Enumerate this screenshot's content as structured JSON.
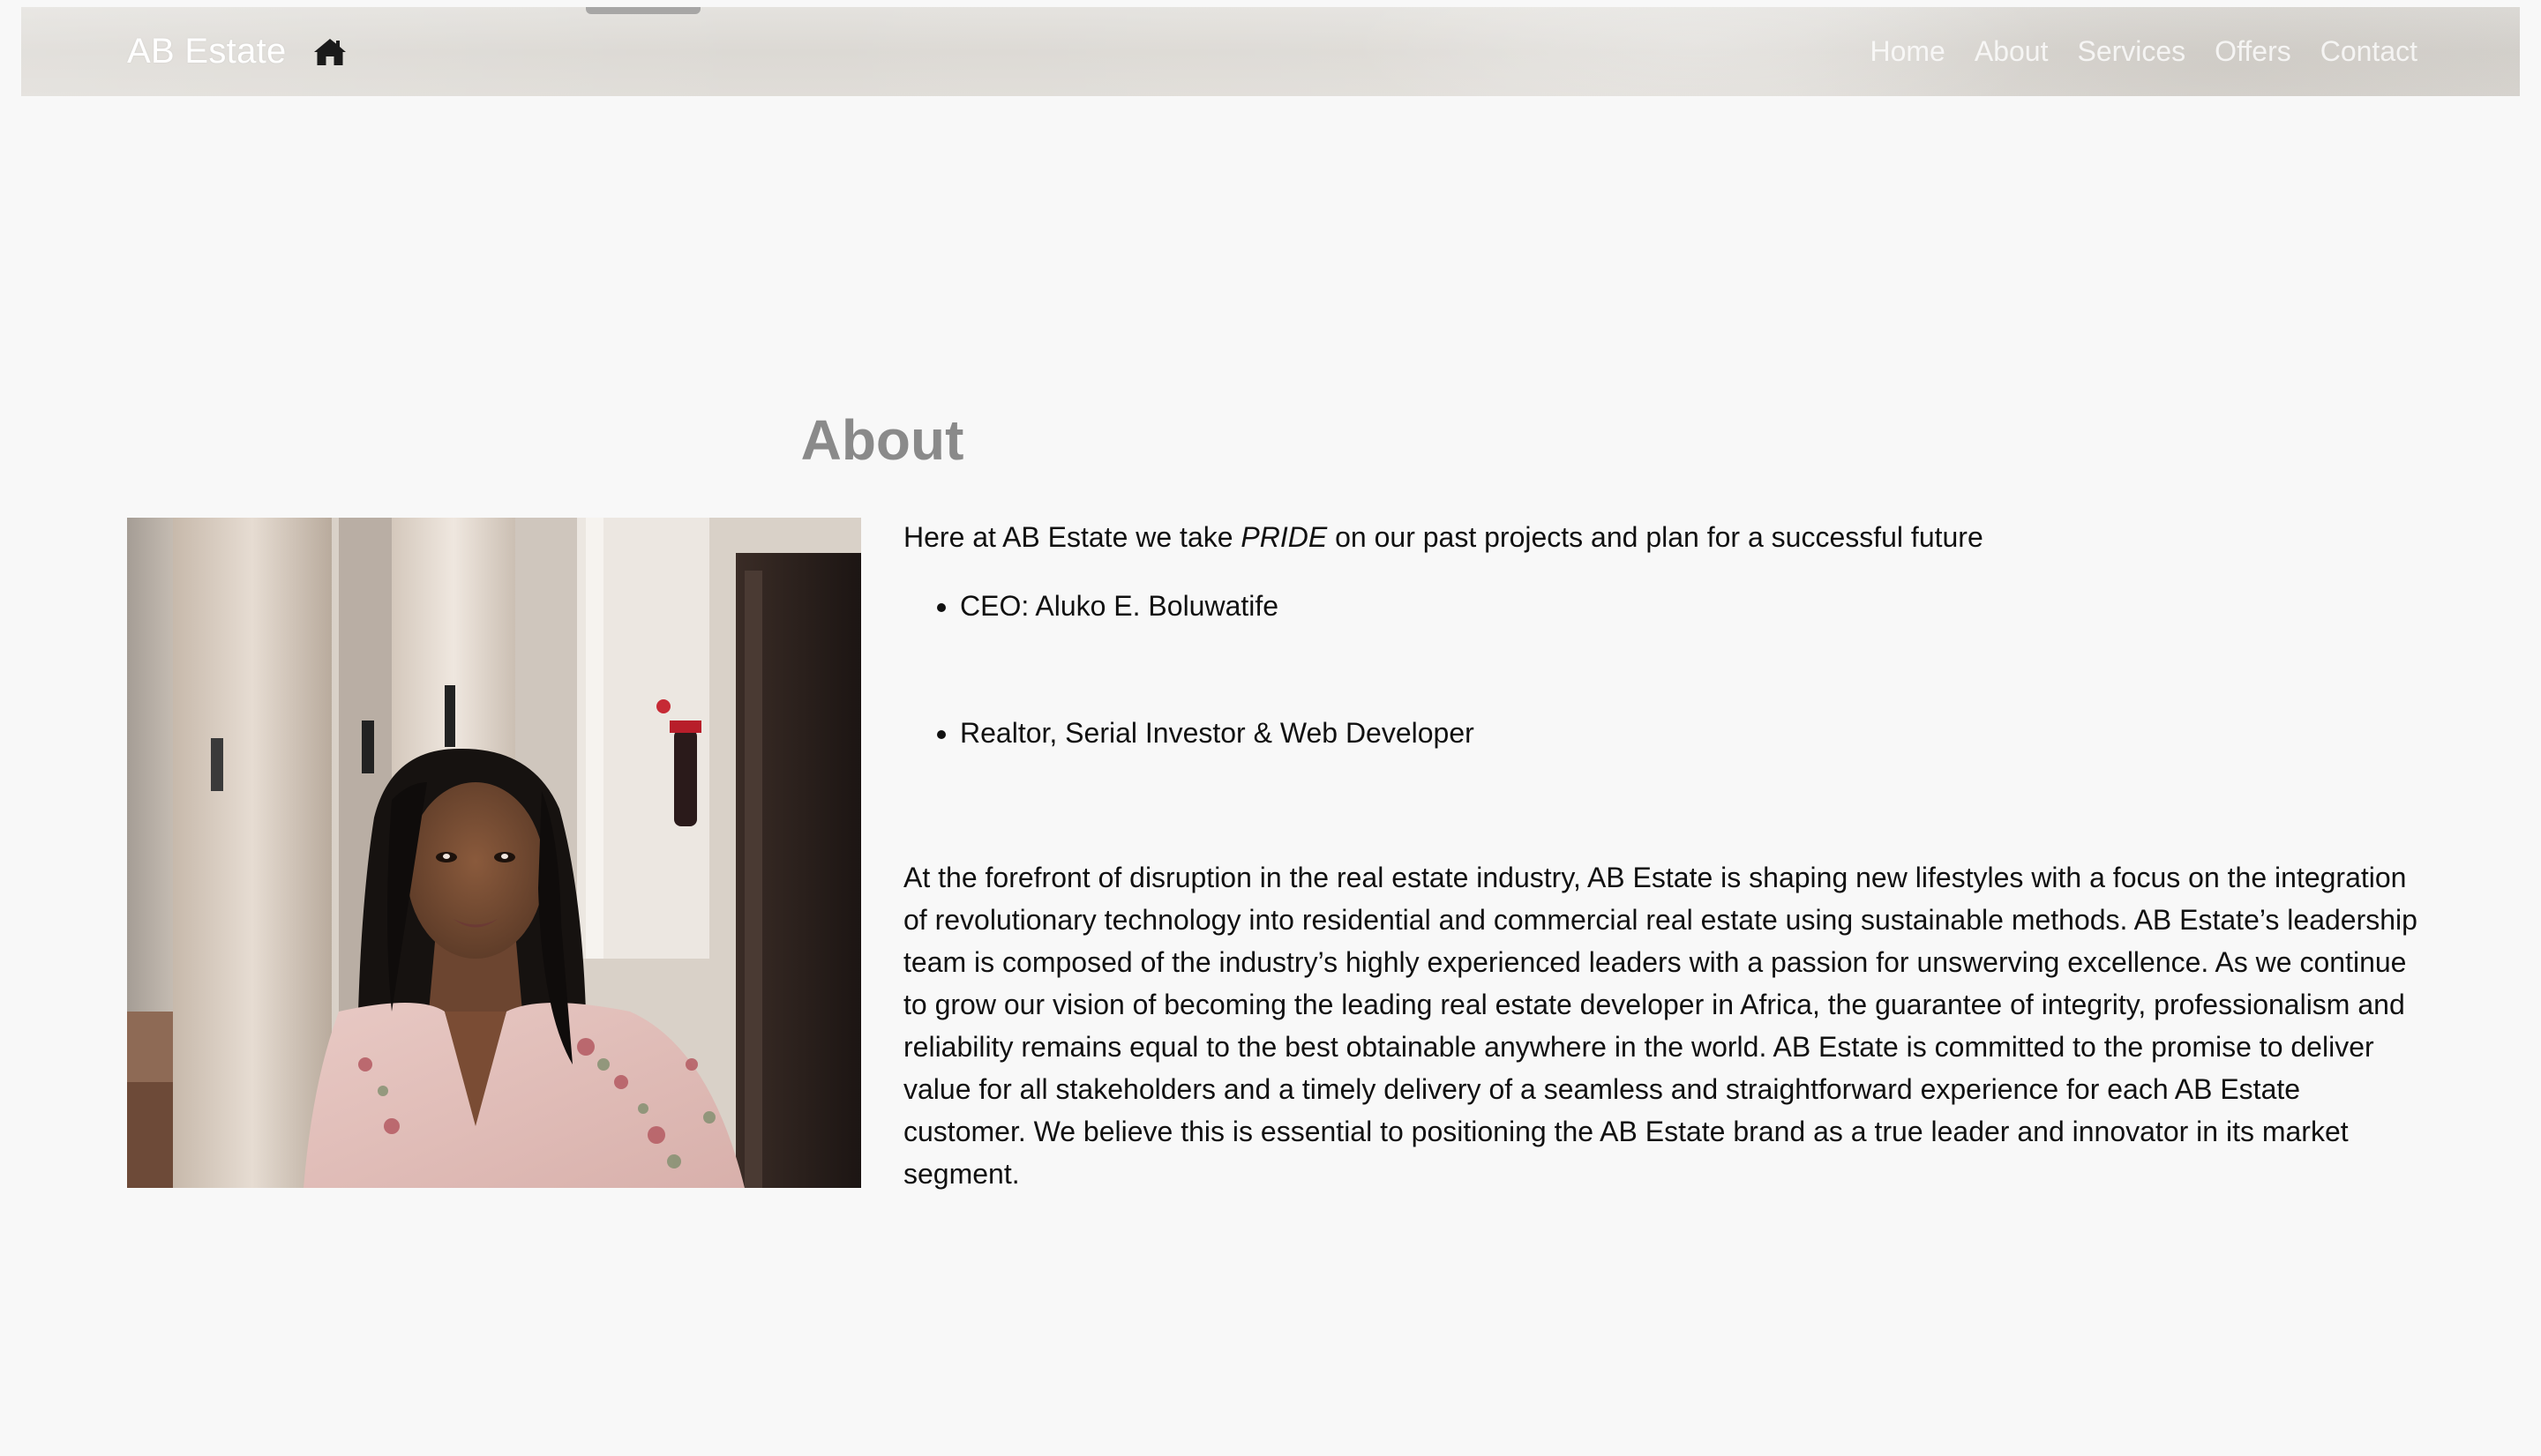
{
  "navbar": {
    "brand": "AB Estate",
    "links": [
      {
        "label": "Home"
      },
      {
        "label": "About"
      },
      {
        "label": "Services"
      },
      {
        "label": "Offers"
      },
      {
        "label": "Contact"
      }
    ]
  },
  "about": {
    "title": "About",
    "intro_before": "Here at AB Estate we take ",
    "intro_emphasis": "PRIDE",
    "intro_after": " on our past projects and plan for a successful future",
    "bullets": [
      "CEO: Aluko E. Boluwatife",
      "Realtor, Serial Investor & Web Developer"
    ],
    "body": "At the forefront of disruption in the real estate industry, AB Estate is shaping new lifestyles with a focus on the integration of revolutionary technology into residential and commercial real estate using sustainable methods. AB Estate’s leadership team is composed of the industry’s highly experienced leaders with a passion for unswerving excellence. As we continue to grow our vision of becoming the leading real estate developer in Africa, the guarantee of integrity, professionalism and reliability remains equal to the best obtainable anywhere in the world. AB Estate is committed to the promise to deliver value for all stakeholders and a timely delivery of a seamless and straightforward experience for each AB Estate customer. We believe this is essential to positioning the AB Estate brand as a true leader and innovator in its market segment."
  },
  "icons": {
    "home": "home-icon"
  }
}
